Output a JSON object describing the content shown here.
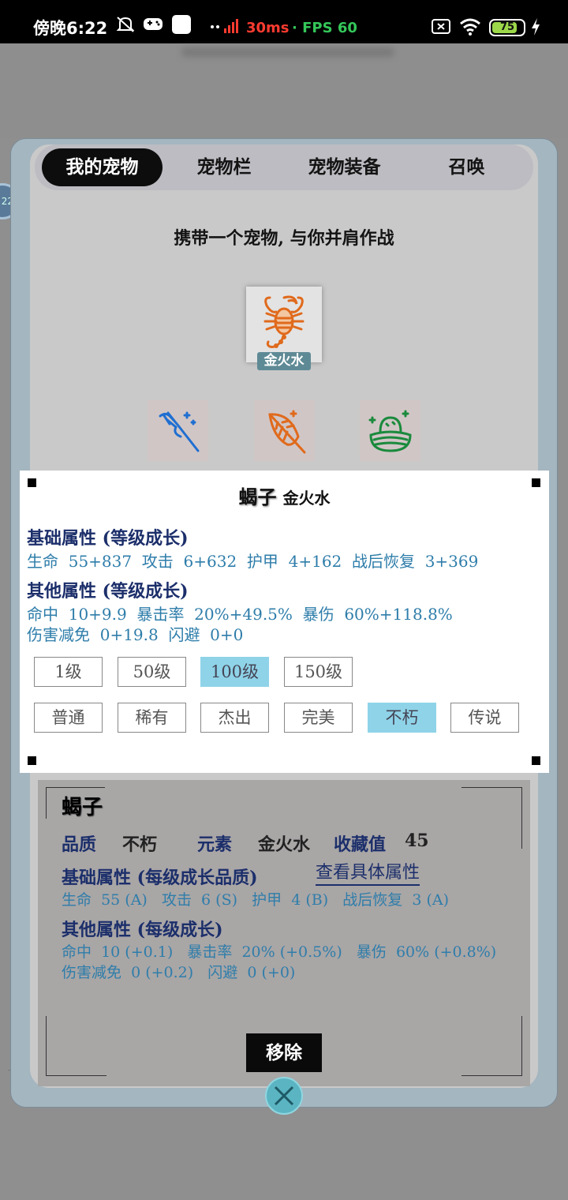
{
  "status_bar": {
    "time": "傍晚6:22",
    "ping": "30ms",
    "fps_label": "· FPS 60",
    "battery": "75"
  },
  "side_badge": "22",
  "tabs": [
    {
      "label": "我的宠物",
      "active": true
    },
    {
      "label": "宠物栏",
      "active": false
    },
    {
      "label": "宠物装备",
      "active": false
    },
    {
      "label": "召唤",
      "active": false
    }
  ],
  "subtitle": "携带一个宠物, 与你并肩作战",
  "pet_slot": {
    "icon": "scorpion-icon",
    "element_tag": "金火水",
    "icon_color": "#e06a1c"
  },
  "equip_slots": [
    {
      "icon": "staff-icon",
      "color": "#1f6fd1"
    },
    {
      "icon": "feather-icon",
      "color": "#e06a1c"
    },
    {
      "icon": "nest-icon",
      "color": "#1a8a3c"
    }
  ],
  "popup": {
    "name": "蝎子",
    "element": "金火水",
    "base_header": "基础属性 (等级成长)",
    "base_line": "生命  55+837  攻击  6+632  护甲  4+162  战后恢复  3+369",
    "other_header": "其他属性 (等级成长)",
    "other_line1": "命中  10+9.9  暴击率  20%+49.5%  暴伤  60%+118.8%",
    "other_line2": "伤害减免  0+19.8  闪避  0+0",
    "levels": [
      {
        "label": "1级",
        "on": false
      },
      {
        "label": "50级",
        "on": false
      },
      {
        "label": "100级",
        "on": true
      },
      {
        "label": "150级",
        "on": false
      }
    ],
    "qualities": [
      {
        "label": "普通",
        "on": false
      },
      {
        "label": "稀有",
        "on": false
      },
      {
        "label": "杰出",
        "on": false
      },
      {
        "label": "完美",
        "on": false
      },
      {
        "label": "不朽",
        "on": true
      },
      {
        "label": "传说",
        "on": false
      }
    ]
  },
  "info": {
    "name": "蝎子",
    "quality_label": "品质",
    "quality_value": "不朽",
    "element_label": "元素",
    "element_value": "金火水",
    "collect_label": "收藏值",
    "collect_value": "45",
    "base_header": "基础属性 (每级成长品质)",
    "detail_link": "查看具体属性",
    "base_line": "生命  55 (A)   攻击  6 (S)   护甲  4 (B)   战后恢复  3 (A)",
    "other_header": "其他属性 (每级成长)",
    "other_line1": "命中  10 (+0.1)   暴击率  20% (+0.5%)   暴伤  60% (+0.8%)",
    "other_line2": "伤害减免  0 (+0.2)   闪避  0 (+0)"
  },
  "remove_label": "移除",
  "close_icon": "close-icon"
}
